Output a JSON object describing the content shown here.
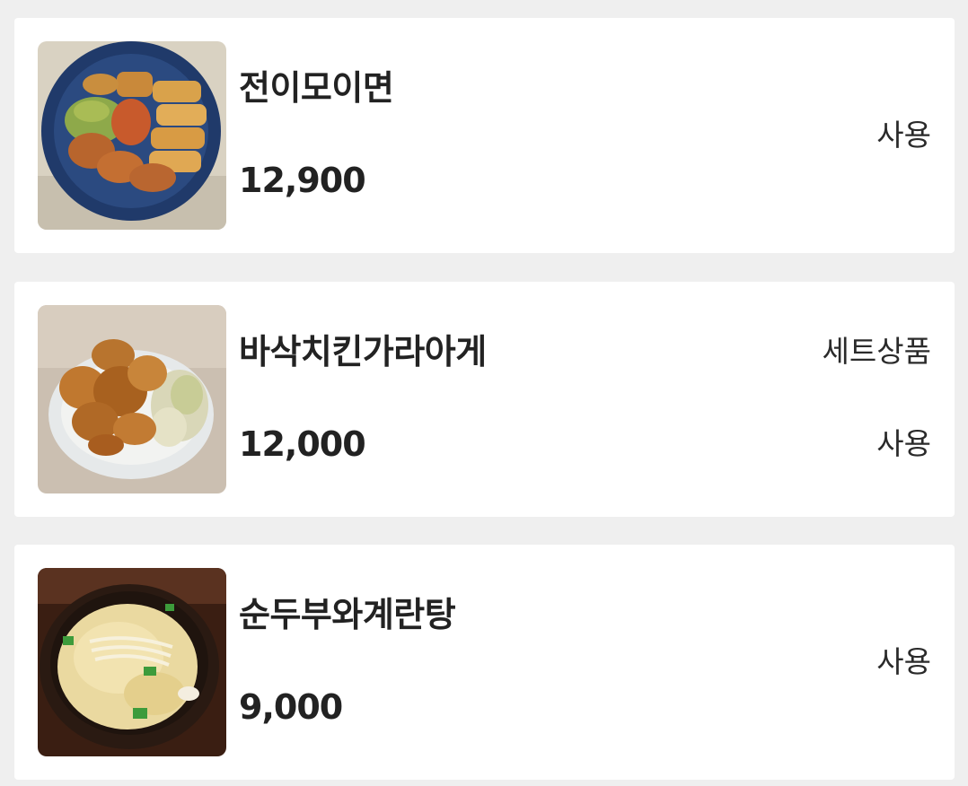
{
  "menu_items": [
    {
      "name": "전이모이면",
      "price": "12,900",
      "status": "사용",
      "image": "fried-jeon-platter"
    },
    {
      "name": "바삭치킨가라아게",
      "price": "12,000",
      "tag": "세트상품",
      "status": "사용",
      "image": "chicken-karaage"
    },
    {
      "name": "순두부와계란탕",
      "price": "9,000",
      "status": "사용",
      "image": "tofu-egg-soup"
    }
  ]
}
